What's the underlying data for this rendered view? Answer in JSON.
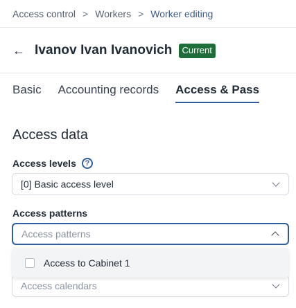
{
  "breadcrumb": {
    "items": [
      "Access control",
      "Workers",
      "Worker editing"
    ],
    "separator": ">"
  },
  "header": {
    "back_icon": "arrow-left-icon",
    "title": "Ivanov Ivan Ivanovich",
    "badge": "Current",
    "badge_color": "#1f6e3a"
  },
  "tabs": [
    {
      "label": "Basic"
    },
    {
      "label": "Accounting records"
    },
    {
      "label": "Access & Pass",
      "active": true
    }
  ],
  "section": {
    "title": "Access data"
  },
  "fields": {
    "access_levels": {
      "label": "Access levels",
      "help_icon": "help-icon",
      "value": "[0] Basic access level"
    },
    "access_patterns": {
      "label": "Access patterns",
      "placeholder": "Access patterns"
    },
    "access_calendars": {
      "placeholder": "Access calendars"
    }
  },
  "dropdown": {
    "options": [
      {
        "label": "Access to Cabinet 1",
        "checked": false
      }
    ]
  },
  "colors": {
    "accent": "#2f5d9c",
    "border": "#d6dbe1"
  }
}
